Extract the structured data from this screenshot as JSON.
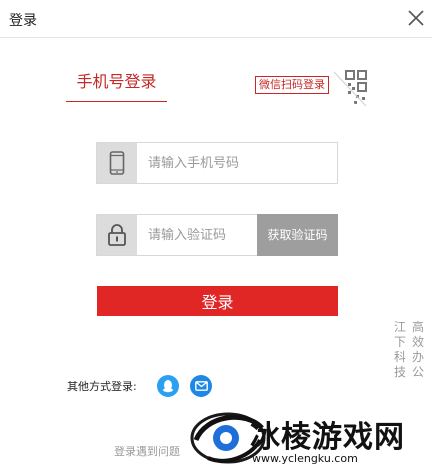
{
  "header": {
    "title": "登录"
  },
  "tabs": {
    "phone": "手机号登录",
    "wechat": "微信扫码登录"
  },
  "phone_field": {
    "placeholder": "请输入手机号码",
    "value": ""
  },
  "code_field": {
    "placeholder": "请输入验证码",
    "value": ""
  },
  "get_code_label": "获取验证码",
  "login_label": "登录",
  "other_methods_label": "其他方式登录:",
  "trouble_link": "登录遇到问题",
  "watermark": {
    "col1": "江下科技",
    "col2": "高效办公",
    "title": "冰棱游戏网",
    "url": "www.yclengku.com"
  },
  "colors": {
    "accent": "#e12626",
    "tab_red": "#c62828",
    "qq": "#2ba0f0",
    "mail": "#1e88e5",
    "button_gray": "#9e9e9e"
  },
  "icons": [
    "close-icon",
    "qr-code-icon",
    "phone-icon",
    "lock-icon",
    "qq-icon",
    "mail-icon"
  ]
}
